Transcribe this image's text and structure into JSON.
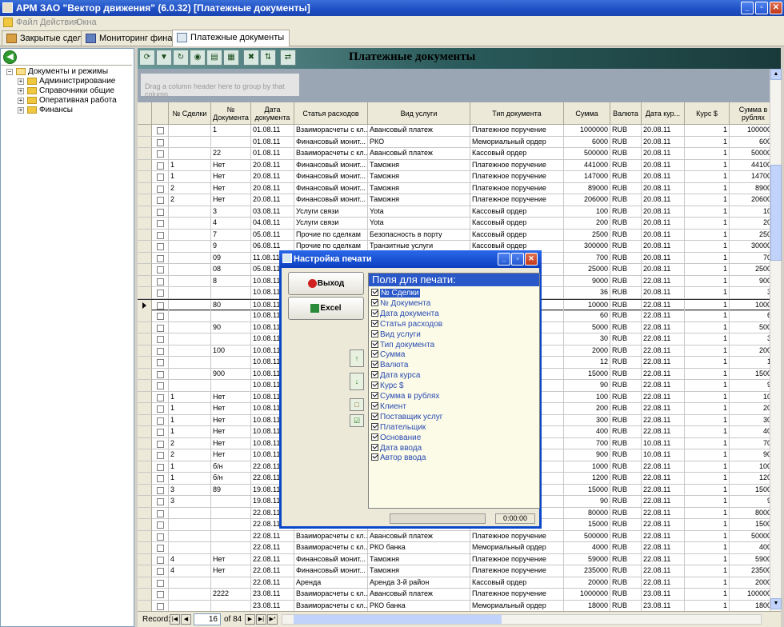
{
  "window": {
    "title": "АРМ ЗАО \"Вектор движения\" (6.0.32)  [Платежные документы]"
  },
  "menu": [
    "Файл",
    "Действия",
    "Окна"
  ],
  "tabs": [
    {
      "label": "Закрытые сделки"
    },
    {
      "label": "Мониторинг финансов"
    },
    {
      "label": "Платежные документы"
    }
  ],
  "tree": {
    "root": "Документы и режимы",
    "children": [
      "Администрирование",
      "Справочники общие",
      "Оперативная работа",
      "Финансы"
    ]
  },
  "toolbar": {
    "title": "Платежные документы"
  },
  "group_hint": "Drag a column header here to group by that column.",
  "columns": [
    "",
    "№ Сделки",
    "№ Документа",
    "Дата документа",
    "Статья расходов",
    "Вид услуги",
    "Тип документа",
    "Сумма",
    "Валюта",
    "Дата кур...",
    "Курс $",
    "Сумма в рублях"
  ],
  "rows": [
    [
      "",
      "1",
      "01.08.11",
      "Взаиморасчеты с кл...",
      "Авансовый платеж",
      "Платежное поручение",
      "1000000",
      "RUB",
      "20.08.11",
      "1",
      "1000000"
    ],
    [
      "",
      "",
      "01.08.11",
      "Финансовый монит...",
      "РКО",
      "Мемориальный ордер",
      "6000",
      "RUB",
      "20.08.11",
      "1",
      "6000"
    ],
    [
      "",
      "22",
      "01.08.11",
      "Взаиморасчеты с кл...",
      "Авансовый платеж",
      "Кассовый ордер",
      "500000",
      "RUB",
      "20.08.11",
      "1",
      "500000"
    ],
    [
      "1",
      "Нет",
      "20.08.11",
      "Финансовый монит...",
      "Таможня",
      "Платежное поручение",
      "441000",
      "RUB",
      "20.08.11",
      "1",
      "441000"
    ],
    [
      "1",
      "Нет",
      "20.08.11",
      "Финансовый монит...",
      "Таможня",
      "Платежное поручение",
      "147000",
      "RUB",
      "20.08.11",
      "1",
      "147000"
    ],
    [
      "2",
      "Нет",
      "20.08.11",
      "Финансовый монит...",
      "Таможня",
      "Платежное поручение",
      "89000",
      "RUB",
      "20.08.11",
      "1",
      "89000"
    ],
    [
      "2",
      "Нет",
      "20.08.11",
      "Финансовый монит...",
      "Таможня",
      "Платежное поручение",
      "206000",
      "RUB",
      "20.08.11",
      "1",
      "206000"
    ],
    [
      "",
      "3",
      "03.08.11",
      "Услуги связи",
      "Yota",
      "Кассовый ордер",
      "100",
      "RUB",
      "20.08.11",
      "1",
      "100"
    ],
    [
      "",
      "4",
      "04.08.11",
      "Услуги связи",
      "Yota",
      "Кассовый ордер",
      "200",
      "RUB",
      "20.08.11",
      "1",
      "200"
    ],
    [
      "",
      "7",
      "05.08.11",
      "Прочие по сделкам",
      "Безопасность в порту",
      "Кассовый ордер",
      "2500",
      "RUB",
      "20.08.11",
      "1",
      "2500"
    ],
    [
      "",
      "9",
      "06.08.11",
      "Прочие по сделкам",
      "Транзитные услуги",
      "Кассовый ордер",
      "300000",
      "RUB",
      "20.08.11",
      "1",
      "300000"
    ],
    [
      "",
      "09",
      "11.08.11",
      "",
      "",
      "",
      "700",
      "RUB",
      "20.08.11",
      "1",
      "700"
    ],
    [
      "",
      "08",
      "05.08.11",
      "",
      "",
      "",
      "25000",
      "RUB",
      "20.08.11",
      "1",
      "25000"
    ],
    [
      "",
      "8",
      "10.08.11",
      "",
      "",
      "",
      "9000",
      "RUB",
      "22.08.11",
      "1",
      "9000"
    ],
    [
      "",
      "",
      "10.08.11",
      "",
      "",
      "",
      "36",
      "RUB",
      "20.08.11",
      "1",
      "36"
    ],
    [
      "",
      "80",
      "10.08.11",
      "",
      "",
      "",
      "10000",
      "RUB",
      "22.08.11",
      "1",
      "10000"
    ],
    [
      "",
      "",
      "10.08.11",
      "",
      "",
      "",
      "60",
      "RUB",
      "22.08.11",
      "1",
      "60"
    ],
    [
      "",
      "90",
      "10.08.11",
      "",
      "",
      "",
      "5000",
      "RUB",
      "22.08.11",
      "1",
      "5000"
    ],
    [
      "",
      "",
      "10.08.11",
      "",
      "",
      "",
      "30",
      "RUB",
      "22.08.11",
      "1",
      "30"
    ],
    [
      "",
      "100",
      "10.08.11",
      "",
      "",
      "",
      "2000",
      "RUB",
      "22.08.11",
      "1",
      "2000"
    ],
    [
      "",
      "",
      "10.08.11",
      "",
      "",
      "",
      "12",
      "RUB",
      "22.08.11",
      "1",
      "12"
    ],
    [
      "",
      "900",
      "10.08.11",
      "",
      "",
      "",
      "15000",
      "RUB",
      "22.08.11",
      "1",
      "15000"
    ],
    [
      "",
      "",
      "10.08.11",
      "",
      "",
      "",
      "90",
      "RUB",
      "22.08.11",
      "1",
      "90"
    ],
    [
      "1",
      "Нет",
      "10.08.11",
      "",
      "",
      "",
      "100",
      "RUB",
      "22.08.11",
      "1",
      "100"
    ],
    [
      "1",
      "Нет",
      "10.08.11",
      "",
      "",
      "",
      "200",
      "RUB",
      "22.08.11",
      "1",
      "200"
    ],
    [
      "1",
      "Нет",
      "10.08.11",
      "",
      "",
      "",
      "300",
      "RUB",
      "22.08.11",
      "1",
      "300"
    ],
    [
      "1",
      "Нет",
      "10.08.11",
      "",
      "",
      "",
      "400",
      "RUB",
      "22.08.11",
      "1",
      "400"
    ],
    [
      "2",
      "Нет",
      "10.08.11",
      "",
      "",
      "",
      "700",
      "RUB",
      "10.08.11",
      "1",
      "700"
    ],
    [
      "2",
      "Нет",
      "10.08.11",
      "",
      "",
      "",
      "900",
      "RUB",
      "10.08.11",
      "1",
      "900"
    ],
    [
      "1",
      "б/н",
      "22.08.11",
      "",
      "",
      "",
      "1000",
      "RUB",
      "22.08.11",
      "1",
      "1000"
    ],
    [
      "1",
      "б/н",
      "22.08.11",
      "",
      "",
      "",
      "1200",
      "RUB",
      "22.08.11",
      "1",
      "1200"
    ],
    [
      "3",
      "89",
      "19.08.11",
      "",
      "",
      "",
      "15000",
      "RUB",
      "22.08.11",
      "1",
      "15000"
    ],
    [
      "3",
      "",
      "19.08.11",
      "",
      "",
      "",
      "90",
      "RUB",
      "22.08.11",
      "1",
      "90"
    ],
    [
      "",
      "",
      "22.08.11",
      "",
      "",
      "",
      "80000",
      "RUB",
      "22.08.11",
      "1",
      "80000"
    ],
    [
      "",
      "",
      "22.08.11",
      "",
      "",
      "",
      "15000",
      "RUB",
      "22.08.11",
      "1",
      "15000"
    ],
    [
      "",
      "",
      "22.08.11",
      "Взаиморасчеты с кл...",
      "Авансовый платеж",
      "Платежное поручение",
      "500000",
      "RUB",
      "22.08.11",
      "1",
      "500000"
    ],
    [
      "",
      "",
      "22.08.11",
      "Взаиморасчеты с кл...",
      "РКО банка",
      "Мемориальный ордер",
      "4000",
      "RUB",
      "22.08.11",
      "1",
      "4000"
    ],
    [
      "4",
      "Нет",
      "22.08.11",
      "Финансовый монит...",
      "Таможня",
      "Платежное поручение",
      "59000",
      "RUB",
      "22.08.11",
      "1",
      "59000"
    ],
    [
      "4",
      "Нет",
      "22.08.11",
      "Финансовый монит...",
      "Таможня",
      "Платежное поручение",
      "235000",
      "RUB",
      "22.08.11",
      "1",
      "235000"
    ],
    [
      "",
      "",
      "22.08.11",
      "Аренда",
      "Аренда 3-й район",
      "Кассовый ордер",
      "20000",
      "RUB",
      "22.08.11",
      "1",
      "20000"
    ],
    [
      "",
      "2222",
      "23.08.11",
      "Взаиморасчеты с кл...",
      "Авансовый платеж",
      "Платежное поручение",
      "1000000",
      "RUB",
      "23.08.11",
      "1",
      "1000000"
    ],
    [
      "",
      "",
      "23.08.11",
      "Взаиморасчеты с кл...",
      "РКО банка",
      "Мемориальный ордер",
      "18000",
      "RUB",
      "23.08.11",
      "1",
      "18000"
    ]
  ],
  "current_row_index": 15,
  "navigator": {
    "label": "Record:",
    "current": "16",
    "of_text": "of 84"
  },
  "dialog": {
    "title": "Настройка печати",
    "exit_label": "Выход",
    "excel_label": "Excel",
    "fields_header": "Поля для печати:",
    "fields": [
      "№ Сделки",
      "№ Документа",
      "Дата документа",
      "Статья расходов",
      "Вид услуги",
      "Тип документа",
      "Сумма",
      "Валюта",
      "Дата курса",
      "Курс $",
      "Сумма в рублях",
      "Клиент",
      "Поставщик услуг",
      "Плательщик",
      "Основание",
      "Дата ввода",
      "Автор ввода"
    ],
    "timer": "0:00:00"
  }
}
